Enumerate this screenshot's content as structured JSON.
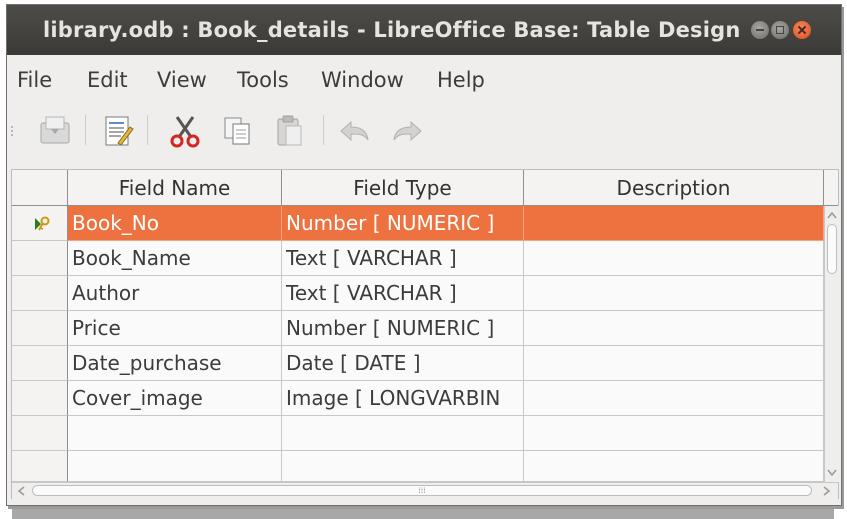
{
  "window": {
    "title": "library.odb : Book_details - LibreOffice Base: Table Design"
  },
  "menu": [
    {
      "label": "File"
    },
    {
      "label": "Edit"
    },
    {
      "label": "View"
    },
    {
      "label": "Tools"
    },
    {
      "label": "Window"
    },
    {
      "label": "Help"
    }
  ],
  "toolbar": {
    "icons": [
      "save-icon",
      "edit-document-icon",
      "cut-icon",
      "copy-icon",
      "paste-icon",
      "undo-icon",
      "redo-icon"
    ]
  },
  "table": {
    "columns": [
      "Field Name",
      "Field Type",
      "Description"
    ],
    "rows": [
      {
        "name": "Book_No",
        "type": "Number [ NUMERIC ]",
        "description": "",
        "primary_key": true
      },
      {
        "name": "Book_Name",
        "type": "Text [ VARCHAR ]",
        "description": ""
      },
      {
        "name": "Author",
        "type": "Text [ VARCHAR ]",
        "description": ""
      },
      {
        "name": "Price",
        "type": "Number [ NUMERIC ]",
        "description": ""
      },
      {
        "name": "Date_purchase",
        "type": "Date [ DATE ]",
        "description": ""
      },
      {
        "name": "Cover_image",
        "type": "Image [ LONGVARBIN",
        "description": ""
      },
      {
        "name": "",
        "type": "",
        "description": ""
      },
      {
        "name": "",
        "type": "",
        "description": ""
      }
    ]
  },
  "colors": {
    "selection": "#ee7240",
    "titlebar": "#3d3c38",
    "close_button": "#e2561f"
  }
}
